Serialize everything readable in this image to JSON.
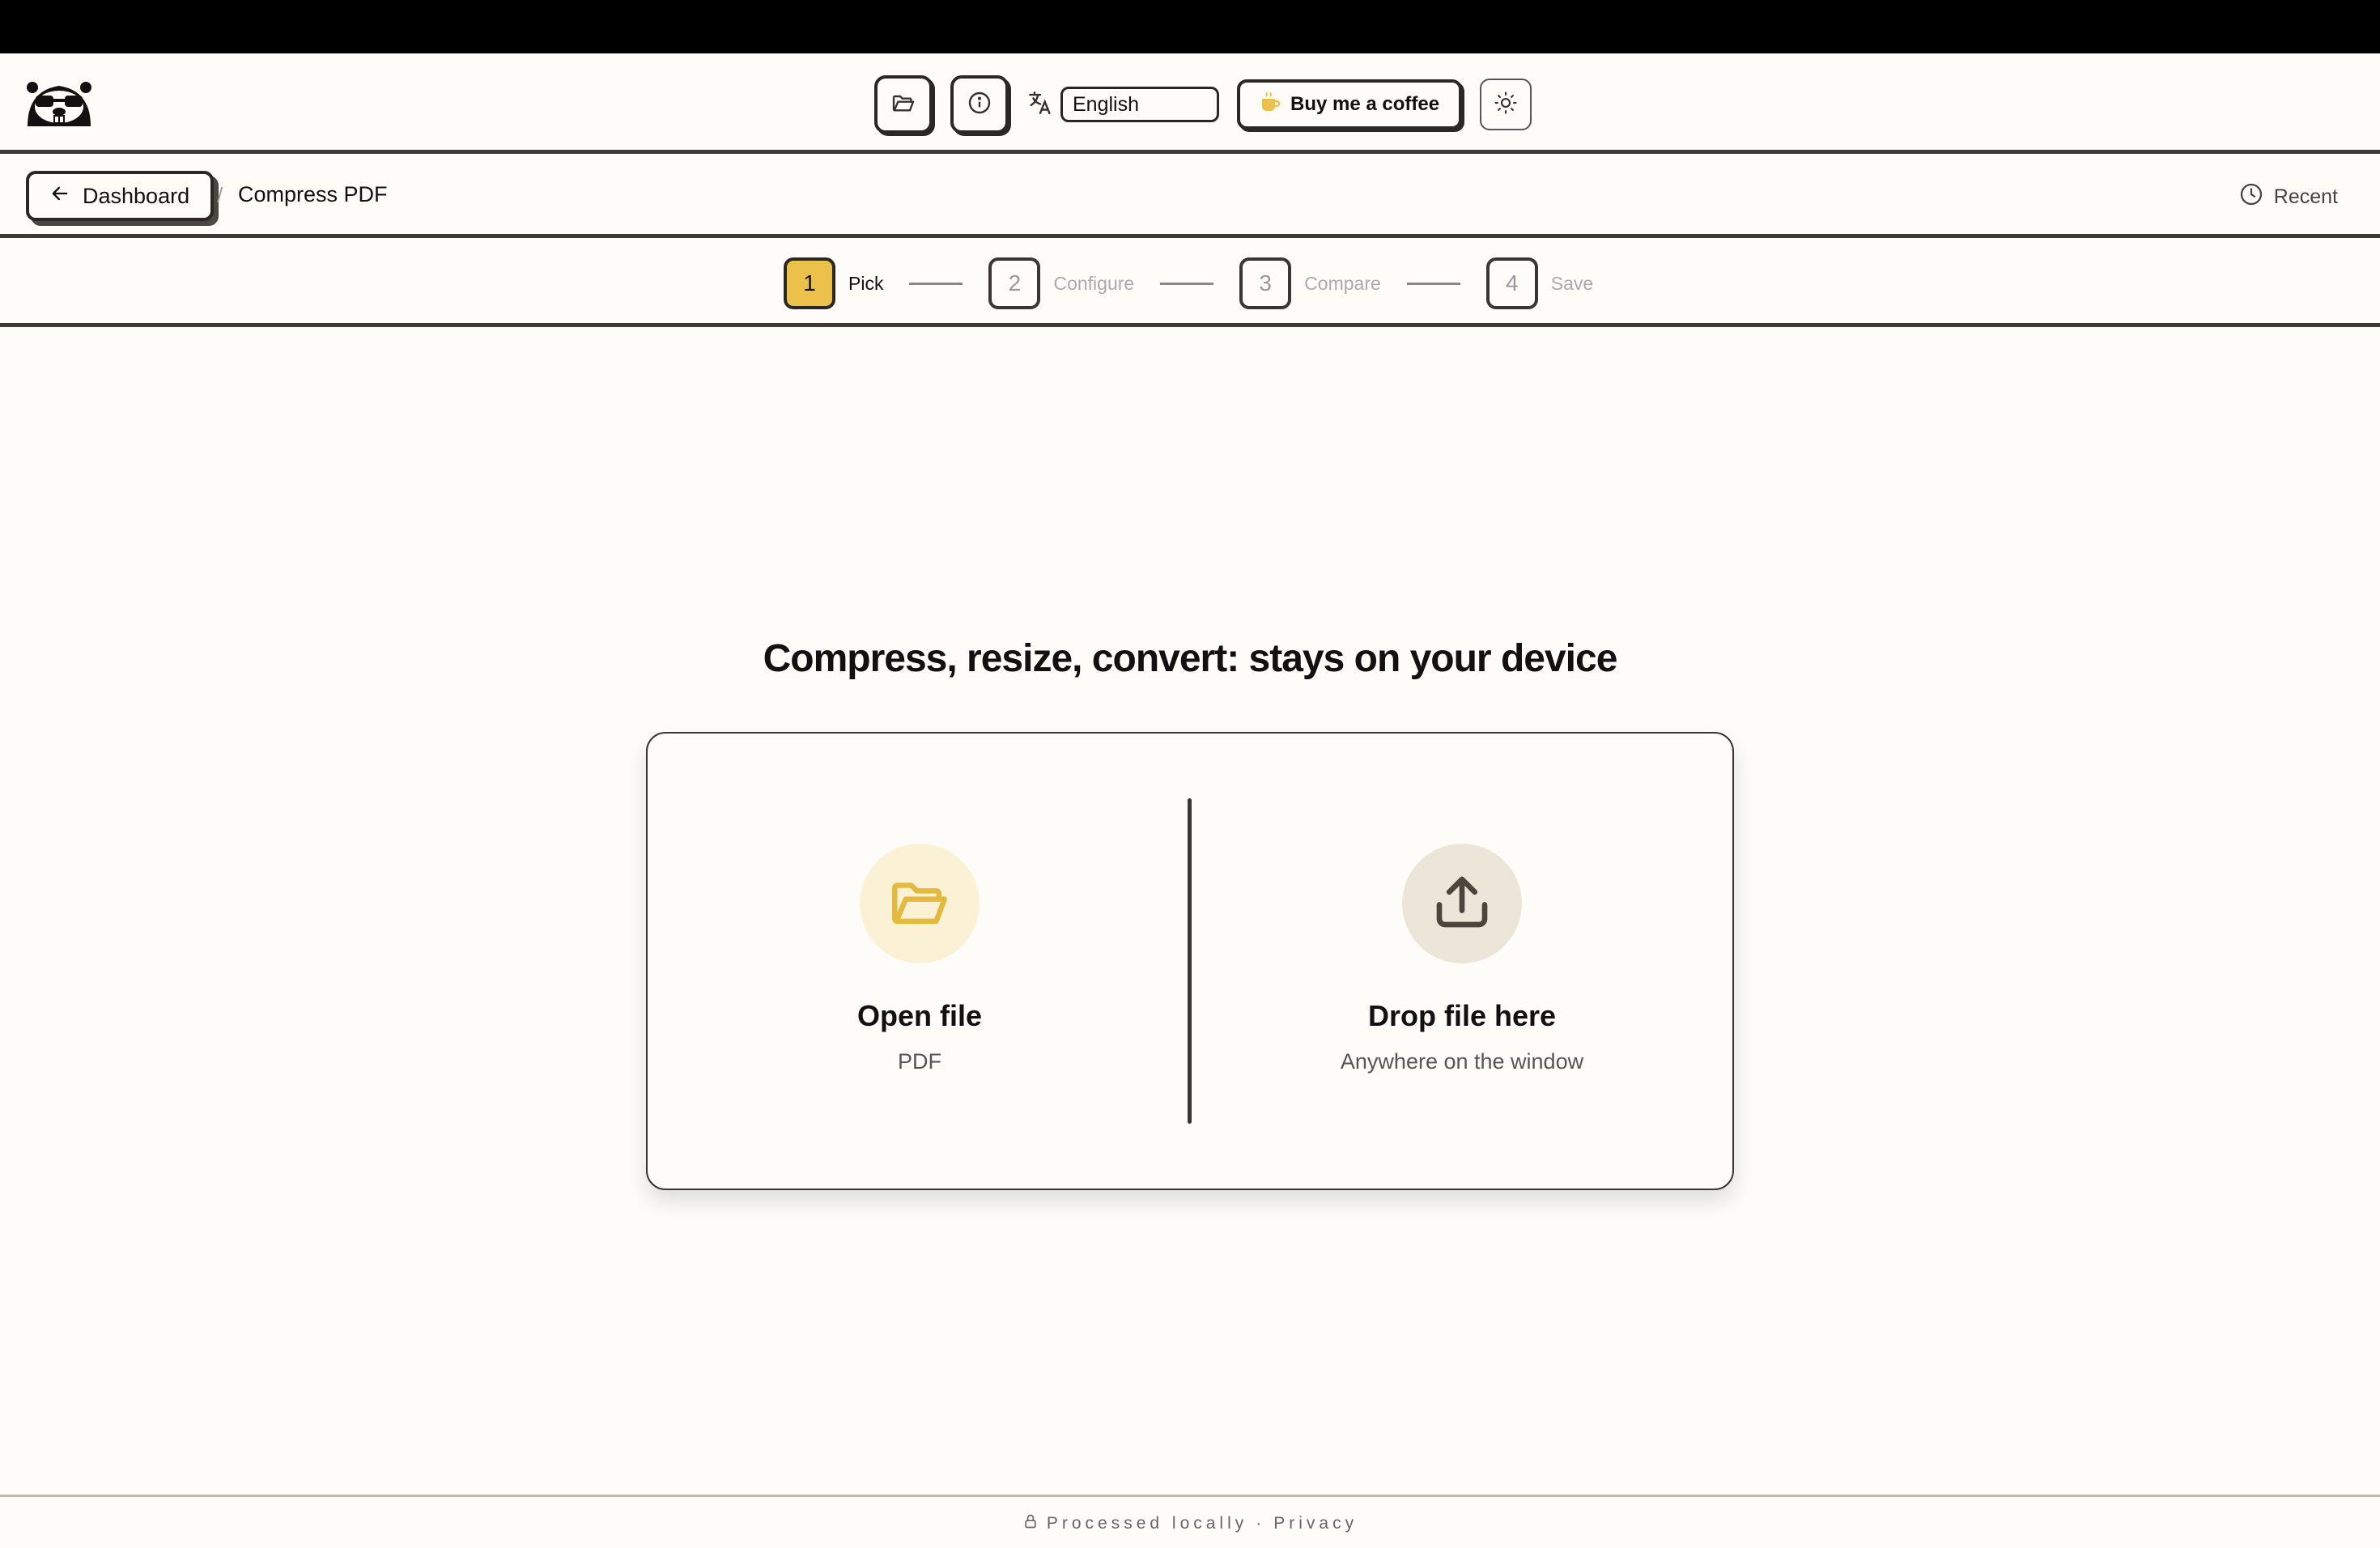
{
  "header": {
    "logo_icon": "beaver-logo-icon",
    "open_icon": "folder-open-icon",
    "info_icon": "info-icon",
    "translate_icon": "translate-icon",
    "language": "English",
    "coffee_label": "Buy me a coffee",
    "coffee_icon": "coffee-cup-icon",
    "theme_icon": "sun-icon"
  },
  "breadcrumb": {
    "back_label": "Dashboard",
    "separator": "/",
    "current": "Compress PDF",
    "recent_label": "Recent"
  },
  "stepper": {
    "steps": [
      {
        "number": "1",
        "label": "Pick",
        "active": true
      },
      {
        "number": "2",
        "label": "Configure",
        "active": false
      },
      {
        "number": "3",
        "label": "Compare",
        "active": false
      },
      {
        "number": "4",
        "label": "Save",
        "active": false
      }
    ]
  },
  "main": {
    "headline": "Compress, resize, convert: stays on your device",
    "open": {
      "title": "Open file",
      "subtitle": "PDF",
      "icon": "folder-open-icon"
    },
    "drop": {
      "title": "Drop file here",
      "subtitle": "Anywhere on the window",
      "icon": "upload-icon"
    }
  },
  "footer": {
    "processed": "Processed locally",
    "dot": "·",
    "privacy": "Privacy"
  },
  "colors": {
    "accent": "#ecc14b",
    "background": "#fdfcf8",
    "border": "#2a2824"
  }
}
